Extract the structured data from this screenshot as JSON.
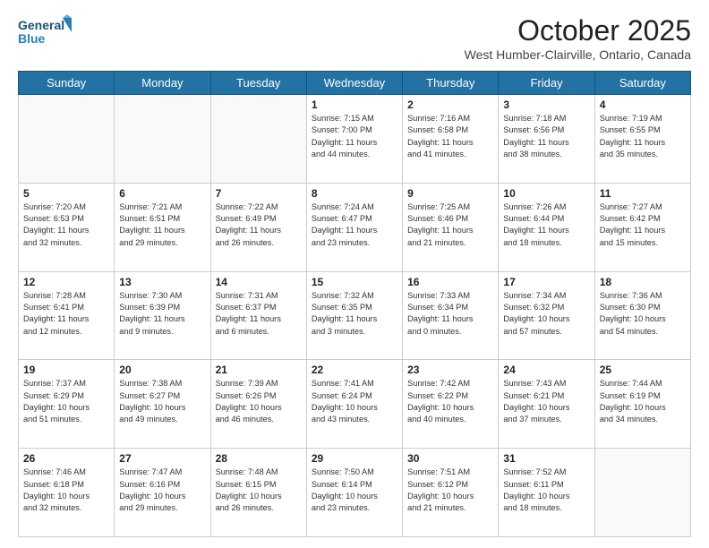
{
  "logo": {
    "line1": "General",
    "line2": "Blue"
  },
  "title": "October 2025",
  "location": "West Humber-Clairville, Ontario, Canada",
  "headers": [
    "Sunday",
    "Monday",
    "Tuesday",
    "Wednesday",
    "Thursday",
    "Friday",
    "Saturday"
  ],
  "weeks": [
    [
      {
        "day": "",
        "info": ""
      },
      {
        "day": "",
        "info": ""
      },
      {
        "day": "",
        "info": ""
      },
      {
        "day": "1",
        "info": "Sunrise: 7:15 AM\nSunset: 7:00 PM\nDaylight: 11 hours\nand 44 minutes."
      },
      {
        "day": "2",
        "info": "Sunrise: 7:16 AM\nSunset: 6:58 PM\nDaylight: 11 hours\nand 41 minutes."
      },
      {
        "day": "3",
        "info": "Sunrise: 7:18 AM\nSunset: 6:56 PM\nDaylight: 11 hours\nand 38 minutes."
      },
      {
        "day": "4",
        "info": "Sunrise: 7:19 AM\nSunset: 6:55 PM\nDaylight: 11 hours\nand 35 minutes."
      }
    ],
    [
      {
        "day": "5",
        "info": "Sunrise: 7:20 AM\nSunset: 6:53 PM\nDaylight: 11 hours\nand 32 minutes."
      },
      {
        "day": "6",
        "info": "Sunrise: 7:21 AM\nSunset: 6:51 PM\nDaylight: 11 hours\nand 29 minutes."
      },
      {
        "day": "7",
        "info": "Sunrise: 7:22 AM\nSunset: 6:49 PM\nDaylight: 11 hours\nand 26 minutes."
      },
      {
        "day": "8",
        "info": "Sunrise: 7:24 AM\nSunset: 6:47 PM\nDaylight: 11 hours\nand 23 minutes."
      },
      {
        "day": "9",
        "info": "Sunrise: 7:25 AM\nSunset: 6:46 PM\nDaylight: 11 hours\nand 21 minutes."
      },
      {
        "day": "10",
        "info": "Sunrise: 7:26 AM\nSunset: 6:44 PM\nDaylight: 11 hours\nand 18 minutes."
      },
      {
        "day": "11",
        "info": "Sunrise: 7:27 AM\nSunset: 6:42 PM\nDaylight: 11 hours\nand 15 minutes."
      }
    ],
    [
      {
        "day": "12",
        "info": "Sunrise: 7:28 AM\nSunset: 6:41 PM\nDaylight: 11 hours\nand 12 minutes."
      },
      {
        "day": "13",
        "info": "Sunrise: 7:30 AM\nSunset: 6:39 PM\nDaylight: 11 hours\nand 9 minutes."
      },
      {
        "day": "14",
        "info": "Sunrise: 7:31 AM\nSunset: 6:37 PM\nDaylight: 11 hours\nand 6 minutes."
      },
      {
        "day": "15",
        "info": "Sunrise: 7:32 AM\nSunset: 6:35 PM\nDaylight: 11 hours\nand 3 minutes."
      },
      {
        "day": "16",
        "info": "Sunrise: 7:33 AM\nSunset: 6:34 PM\nDaylight: 11 hours\nand 0 minutes."
      },
      {
        "day": "17",
        "info": "Sunrise: 7:34 AM\nSunset: 6:32 PM\nDaylight: 10 hours\nand 57 minutes."
      },
      {
        "day": "18",
        "info": "Sunrise: 7:36 AM\nSunset: 6:30 PM\nDaylight: 10 hours\nand 54 minutes."
      }
    ],
    [
      {
        "day": "19",
        "info": "Sunrise: 7:37 AM\nSunset: 6:29 PM\nDaylight: 10 hours\nand 51 minutes."
      },
      {
        "day": "20",
        "info": "Sunrise: 7:38 AM\nSunset: 6:27 PM\nDaylight: 10 hours\nand 49 minutes."
      },
      {
        "day": "21",
        "info": "Sunrise: 7:39 AM\nSunset: 6:26 PM\nDaylight: 10 hours\nand 46 minutes."
      },
      {
        "day": "22",
        "info": "Sunrise: 7:41 AM\nSunset: 6:24 PM\nDaylight: 10 hours\nand 43 minutes."
      },
      {
        "day": "23",
        "info": "Sunrise: 7:42 AM\nSunset: 6:22 PM\nDaylight: 10 hours\nand 40 minutes."
      },
      {
        "day": "24",
        "info": "Sunrise: 7:43 AM\nSunset: 6:21 PM\nDaylight: 10 hours\nand 37 minutes."
      },
      {
        "day": "25",
        "info": "Sunrise: 7:44 AM\nSunset: 6:19 PM\nDaylight: 10 hours\nand 34 minutes."
      }
    ],
    [
      {
        "day": "26",
        "info": "Sunrise: 7:46 AM\nSunset: 6:18 PM\nDaylight: 10 hours\nand 32 minutes."
      },
      {
        "day": "27",
        "info": "Sunrise: 7:47 AM\nSunset: 6:16 PM\nDaylight: 10 hours\nand 29 minutes."
      },
      {
        "day": "28",
        "info": "Sunrise: 7:48 AM\nSunset: 6:15 PM\nDaylight: 10 hours\nand 26 minutes."
      },
      {
        "day": "29",
        "info": "Sunrise: 7:50 AM\nSunset: 6:14 PM\nDaylight: 10 hours\nand 23 minutes."
      },
      {
        "day": "30",
        "info": "Sunrise: 7:51 AM\nSunset: 6:12 PM\nDaylight: 10 hours\nand 21 minutes."
      },
      {
        "day": "31",
        "info": "Sunrise: 7:52 AM\nSunset: 6:11 PM\nDaylight: 10 hours\nand 18 minutes."
      },
      {
        "day": "",
        "info": ""
      }
    ]
  ]
}
